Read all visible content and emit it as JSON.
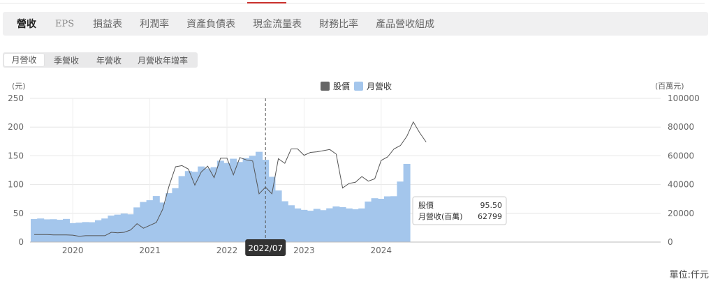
{
  "top_tabs": [
    "營收",
    "EPS",
    "損益表",
    "利潤率",
    "資產負債表",
    "現金流量表",
    "財務比率",
    "產品營收組成"
  ],
  "sub_tabs": [
    "月營收",
    "季營收",
    "年營收",
    "月營收年增率"
  ],
  "legend": {
    "price": "股價",
    "revenue": "月營收"
  },
  "unit_left": "(元)",
  "unit_right": "(百萬元)",
  "unit_note": "單位:仟元",
  "tooltip": {
    "date": "2022/07",
    "price_label": "股價",
    "price_value": "95.50",
    "revenue_label": "月營收(百萬)",
    "revenue_value": "62799"
  },
  "colors": {
    "bar": "#a4c6ec",
    "line": "#555555",
    "accent": "#c9302c",
    "crosshair": "#555555"
  },
  "chart_data": {
    "type": "bar",
    "xlabel": "",
    "ylabel_left": "(元)",
    "ylabel_right": "(百萬元)",
    "ylim_left": [
      0,
      250
    ],
    "ylim_right": [
      0,
      100000
    ],
    "yticks_left": [
      "0",
      "50",
      "100",
      "150",
      "200",
      "250"
    ],
    "yticks_right": [
      "0",
      "20000",
      "40000",
      "60000",
      "80000",
      "100000"
    ],
    "x_tick_labels": [
      "2020",
      "2021",
      "2022",
      "2023",
      "2024"
    ],
    "x_tick_month_index": [
      6,
      18,
      30,
      42,
      54
    ],
    "start_month": "2019/07",
    "highlight_index": 36,
    "grid": true,
    "legend_position": "top-center",
    "series": [
      {
        "name": "月營收",
        "type": "bar",
        "axis": "right",
        "values": [
          16000,
          16400,
          15800,
          15900,
          15500,
          16100,
          13200,
          13500,
          13900,
          13800,
          15200,
          16400,
          18400,
          19100,
          19800,
          19300,
          24100,
          27900,
          29100,
          32000,
          27500,
          34000,
          37500,
          45900,
          49400,
          48900,
          52600,
          51200,
          52100,
          56600,
          55000,
          58000,
          55700,
          58400,
          60000,
          62799,
          57200,
          45400,
          35900,
          28400,
          25600,
          23400,
          22400,
          21800,
          23100,
          22200,
          23500,
          24800,
          24300,
          23400,
          22800,
          23400,
          28200,
          30500,
          30100,
          31800,
          31900,
          42100,
          54400
        ]
      },
      {
        "name": "股價",
        "type": "line",
        "axis": "left",
        "values": [
          13,
          13,
          13,
          12.5,
          12.5,
          12.5,
          12,
          10,
          11,
          11,
          11,
          11,
          17,
          16,
          17,
          21,
          32,
          24,
          29,
          34,
          57,
          98,
          131,
          133,
          127,
          99,
          122,
          132,
          112,
          146,
          146,
          117,
          147,
          143,
          141,
          84,
          95.5,
          84,
          145,
          137,
          162,
          162,
          151,
          156,
          157,
          159,
          161,
          153,
          94,
          102,
          104,
          114,
          106,
          110,
          142,
          148,
          162,
          168,
          184,
          209,
          190,
          174
        ]
      }
    ]
  }
}
